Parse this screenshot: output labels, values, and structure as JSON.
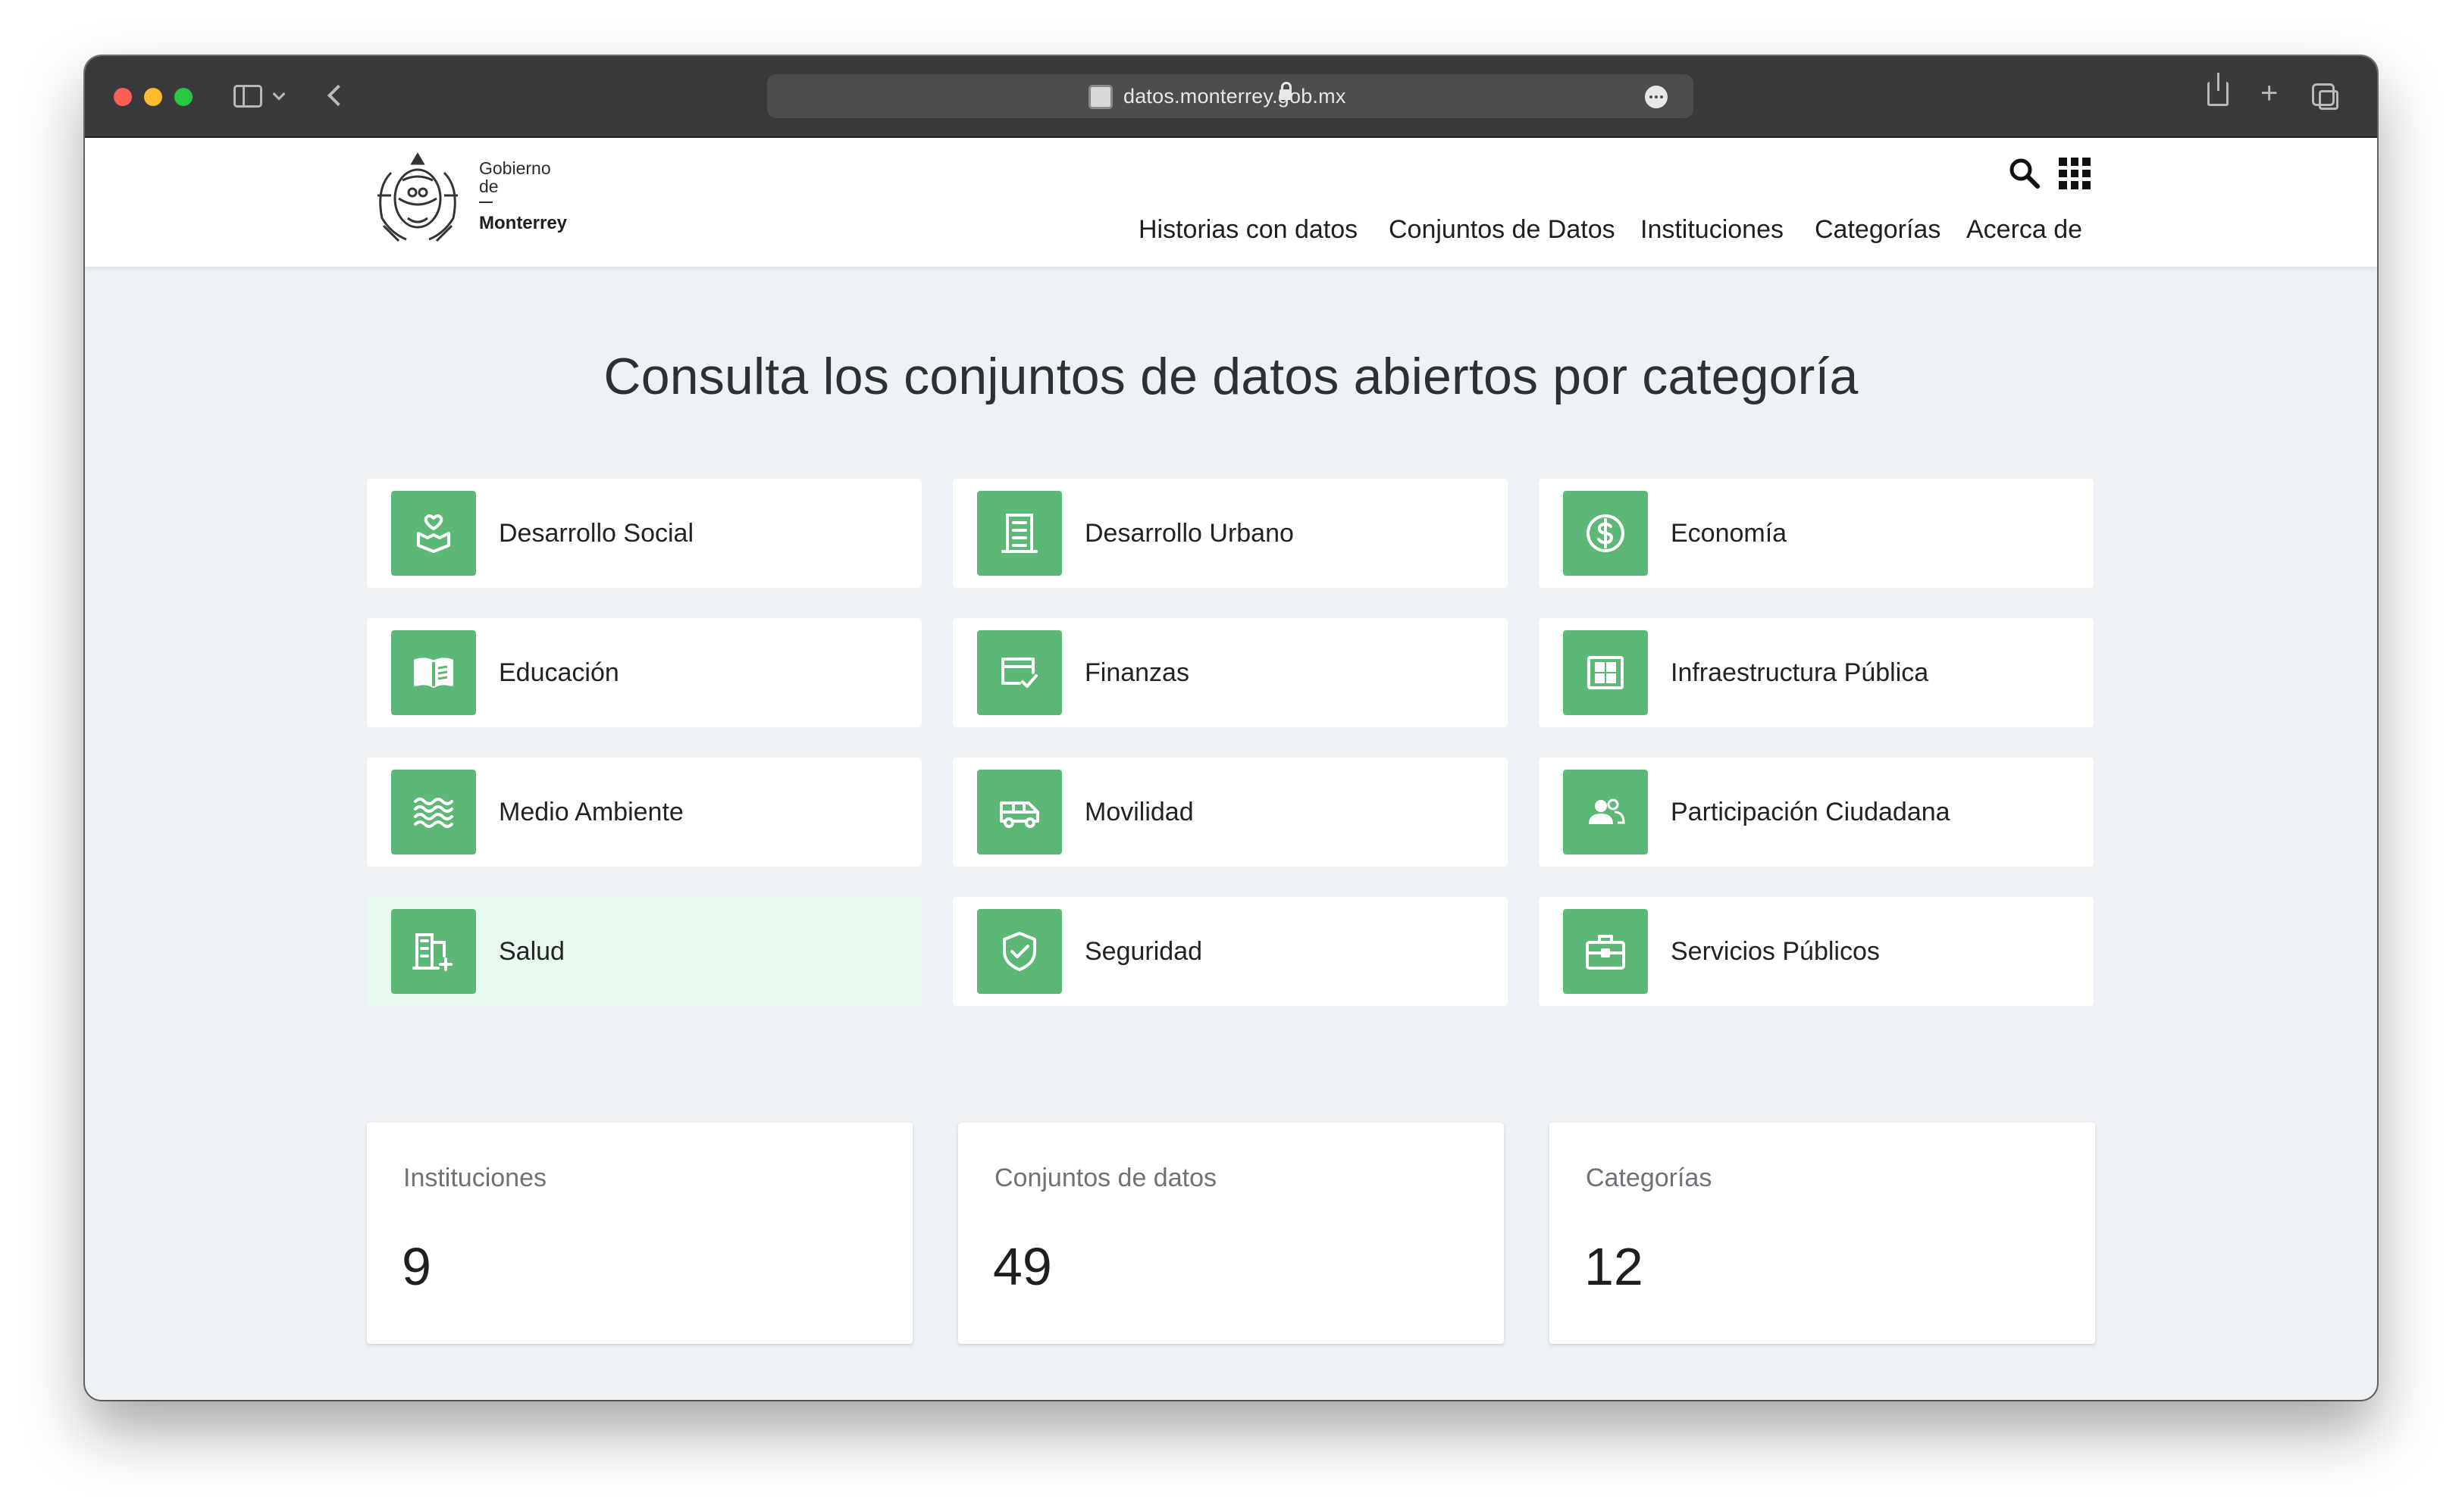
{
  "browser": {
    "url": "datos.monterrey.gob.mx"
  },
  "logo": {
    "line1": "Gobierno",
    "line2": "de",
    "line3": "Monterrey"
  },
  "nav": {
    "items": [
      {
        "label": "Historias con datos"
      },
      {
        "label": "Conjuntos de Datos"
      },
      {
        "label": "Instituciones"
      },
      {
        "label": "Categorías"
      },
      {
        "label": "Acerca de"
      }
    ]
  },
  "main": {
    "headline": "Consulta los conjuntos de datos abiertos por categoría",
    "accent_color": "#5db878",
    "categories": [
      {
        "label": "Desarrollo Social",
        "icon": "hand-heart-icon"
      },
      {
        "label": "Desarrollo Urbano",
        "icon": "building-icon"
      },
      {
        "label": "Economía",
        "icon": "dollar-circle-icon"
      },
      {
        "label": "Educación",
        "icon": "open-book-icon"
      },
      {
        "label": "Finanzas",
        "icon": "card-check-icon"
      },
      {
        "label": "Infraestructura Pública",
        "icon": "grid-panel-icon"
      },
      {
        "label": "Medio Ambiente",
        "icon": "waves-icon"
      },
      {
        "label": "Movilidad",
        "icon": "van-icon"
      },
      {
        "label": "Participación Ciudadana",
        "icon": "people-icon"
      },
      {
        "label": "Salud",
        "icon": "hospital-icon"
      },
      {
        "label": "Seguridad",
        "icon": "shield-check-icon"
      },
      {
        "label": "Servicios Públicos",
        "icon": "briefcase-icon"
      }
    ],
    "stats": [
      {
        "label": "Instituciones",
        "value": "9"
      },
      {
        "label": "Conjuntos de datos",
        "value": "49"
      },
      {
        "label": "Categorías",
        "value": "12"
      }
    ]
  }
}
